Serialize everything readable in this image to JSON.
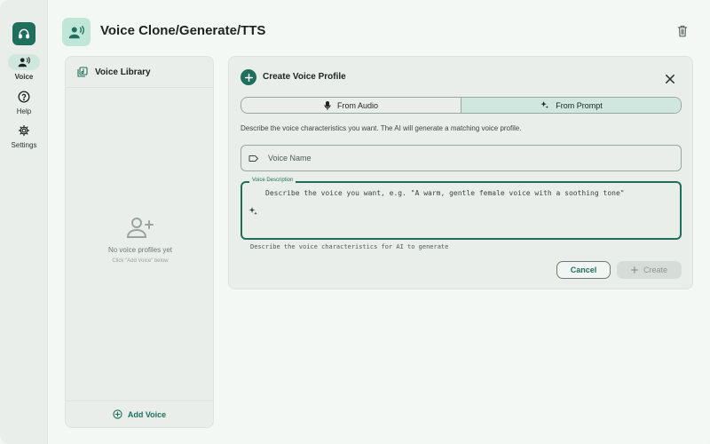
{
  "window": {
    "buttons": [
      "close",
      "minimize",
      "maximize"
    ]
  },
  "sidebar": {
    "logo_icon": "headphones-icon",
    "items": [
      {
        "label": "Voice",
        "icon": "voice-person-icon",
        "active": true
      },
      {
        "label": "Help",
        "icon": "help-circle-icon",
        "active": false
      },
      {
        "label": "Settings",
        "icon": "gear-icon",
        "active": false
      }
    ]
  },
  "header": {
    "title": "Voice Clone/Generate/TTS",
    "icon": "voice-person-icon",
    "trash_icon": "trash-icon"
  },
  "library": {
    "title": "Voice Library",
    "empty_title": "No voice profiles yet",
    "empty_subtitle": "Click \"Add Voice\" below",
    "add_label": "Add Voice"
  },
  "create": {
    "title": "Create Voice Profile",
    "tabs": [
      {
        "label": "From Audio",
        "icon": "microphone-icon",
        "selected": false
      },
      {
        "label": "From Prompt",
        "icon": "sparkle-icon",
        "selected": true
      }
    ],
    "description": "Describe the voice characteristics you want. The AI will generate a matching voice profile.",
    "name_placeholder": "Voice Name",
    "desc_label": "Voice Description",
    "desc_placeholder": "Describe the voice you want, e.g. \"A warm, gentle female voice with a soothing tone\"",
    "helper": "Describe the voice characteristics for AI to generate",
    "cancel_label": "Cancel",
    "create_label": "Create"
  },
  "colors": {
    "accent": "#1f6f5c",
    "accent_light": "#cfe7de",
    "background": "#f4f8f5",
    "panel": "#e9eeeb"
  }
}
